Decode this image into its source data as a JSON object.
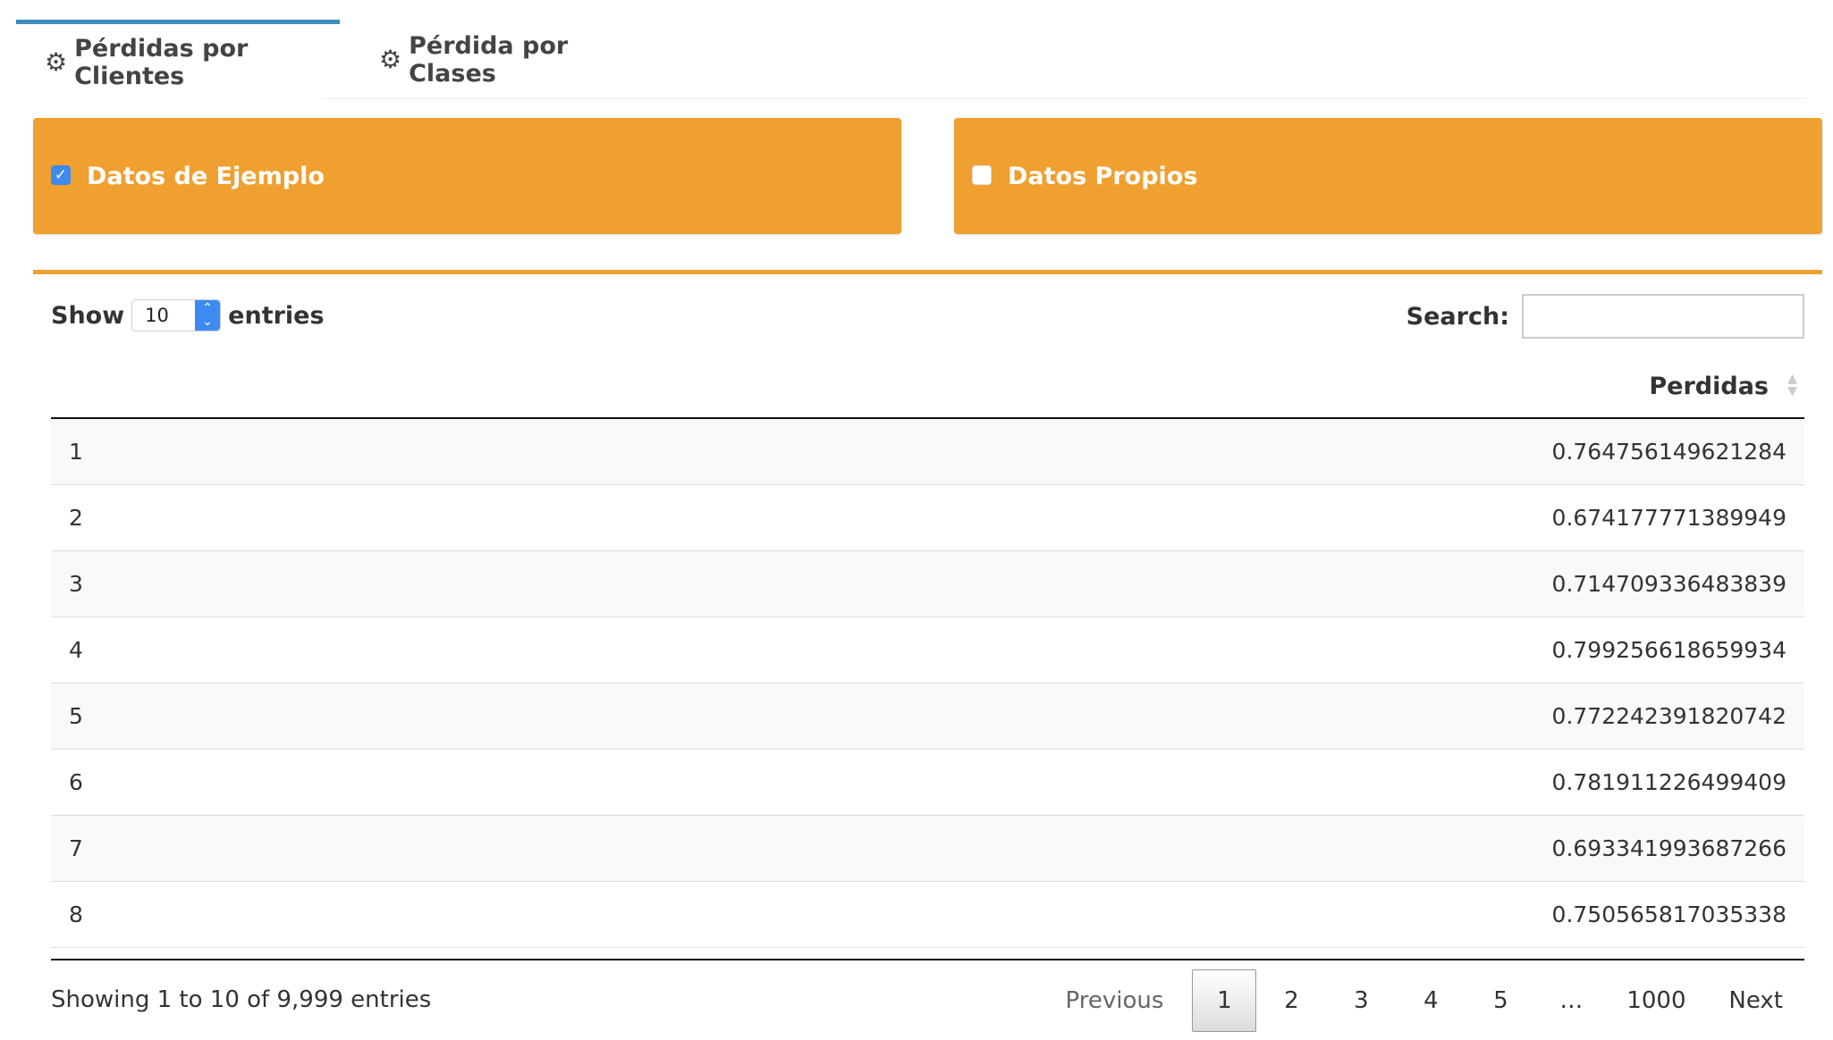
{
  "tabs": [
    {
      "label": "Pérdidas por Clientes",
      "icon": "gear-icon",
      "active": true
    },
    {
      "label": "Pérdida por Clases",
      "icon": "gear-icon",
      "active": false
    }
  ],
  "options": {
    "example_data": {
      "label": "Datos de Ejemplo",
      "checked": true
    },
    "own_data": {
      "label": "Datos Propios",
      "checked": false
    }
  },
  "table": {
    "length_label_pre": "Show",
    "length_value": "10",
    "length_label_post": "entries",
    "search_label": "Search:",
    "search_value": "",
    "column_header": "Perdidas",
    "rows": [
      {
        "index": "1",
        "value": "0.764756149621284"
      },
      {
        "index": "2",
        "value": "0.674177771389949"
      },
      {
        "index": "3",
        "value": "0.714709336483839"
      },
      {
        "index": "4",
        "value": "0.799256618659934"
      },
      {
        "index": "5",
        "value": "0.772242391820742"
      },
      {
        "index": "6",
        "value": "0.781911226499409"
      },
      {
        "index": "7",
        "value": "0.693341993687266"
      },
      {
        "index": "8",
        "value": "0.750565817035338"
      }
    ],
    "info": "Showing 1 to 10 of 9,999 entries",
    "pagination": {
      "previous": "Previous",
      "pages": [
        "1",
        "2",
        "3",
        "4",
        "5"
      ],
      "ellipsis": "…",
      "last": "1000",
      "next": "Next",
      "current": "1"
    }
  },
  "colors": {
    "accent_orange": "#f0a030",
    "tab_accent": "#3c8dbc",
    "checkbox_blue": "#3d8bf0"
  }
}
